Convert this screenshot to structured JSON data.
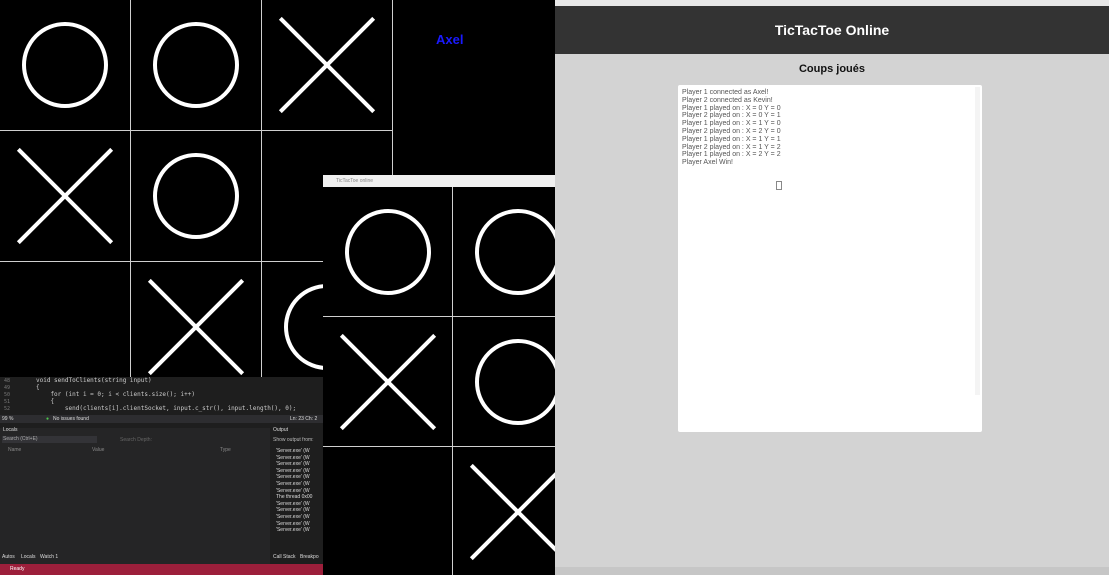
{
  "game_window_1": {
    "player_name": "Axel",
    "board": [
      [
        "O",
        "O",
        "X"
      ],
      [
        "X",
        "O",
        ""
      ],
      [
        "",
        "X",
        "O"
      ]
    ]
  },
  "game_window_2": {
    "title": "TicTacToe online",
    "board": [
      [
        "O",
        "O"
      ],
      [
        "X",
        "O"
      ],
      [
        "",
        "X"
      ]
    ]
  },
  "ide": {
    "code_lines": [
      {
        "n": "48",
        "text": "void sendToClients(string input)"
      },
      {
        "n": "49",
        "text": "{"
      },
      {
        "n": "50",
        "text": "    for (int i = 0; i < clients.size(); i++)"
      },
      {
        "n": "51",
        "text": "    {"
      },
      {
        "n": "52",
        "text": "        send(clients[i].clientSocket, input.c_str(), input.length(), 0);"
      }
    ],
    "zoom": "99 %",
    "issues": "No issues found",
    "position": "Ln: 23   Ch: 2",
    "locals_title": "Locals",
    "search_placeholder": "Search (Ctrl+E)",
    "search_depth": "Search Depth:",
    "col_name": "Name",
    "col_value": "Value",
    "col_type": "Type",
    "bottom_tabs": [
      "Autos",
      "Locals",
      "Watch 1"
    ],
    "output_title": "Output",
    "show_output_from": "Show output from:",
    "output_lines": [
      "'Server.exe' (W",
      "'Server.exe' (W",
      "'Server.exe' (W",
      "'Server.exe' (W",
      "'Server.exe' (W",
      "'Server.exe' (W",
      "'Server.exe' (W",
      "The thread 0x00",
      "'Server.exe' (W",
      "'Server.exe' (W",
      "'Server.exe' (W",
      "'Server.exe' (W",
      "'Server.exe' (W"
    ],
    "output_tabs": [
      "Call Stack",
      "Breakpo"
    ],
    "status": "Ready"
  },
  "browser": {
    "site_title": "TicTacToe Online",
    "moves_heading": "Coups joués",
    "log": [
      "Player 1 connected as Axel!",
      "Player 2 connected as Kevin!",
      "Player 1 played on : X = 0 Y = 0",
      "Player 2 played on : X = 0 Y = 1",
      "Player 1 played on : X = 1 Y = 0",
      "Player 2 played on : X = 2 Y = 0",
      "Player 1 played on : X = 1 Y = 1",
      "Player 2 played on : X = 1 Y = 2",
      "Player 1 played on : X = 2 Y = 2",
      "Player Axel Win!"
    ]
  }
}
